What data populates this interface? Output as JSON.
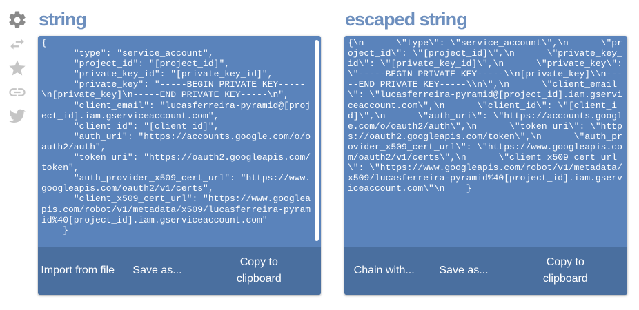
{
  "sidebar": {
    "icons": [
      {
        "name": "gear-icon",
        "color": "#8a8a8a"
      },
      {
        "name": "swap-icon",
        "color": "#c5c5c5"
      },
      {
        "name": "star-icon",
        "color": "#c5c5c5"
      },
      {
        "name": "link-icon",
        "color": "#c5c5c5"
      },
      {
        "name": "twitter-icon",
        "color": "#c5c5c5"
      }
    ]
  },
  "input_panel": {
    "title": "string",
    "content": "{\n      \"type\": \"service_account\",\n      \"project_id\": \"[project_id]\",\n      \"private_key_id\": \"[private_key_id]\",\n      \"private_key\": \"-----BEGIN PRIVATE KEY-----\\n[private_key]\\n-----END PRIVATE KEY-----\\n\",\n      \"client_email\": \"lucasferreira-pyramid@[project_id].iam.gserviceaccount.com\",\n      \"client_id\": \"[client_id]\",\n      \"auth_uri\": \"https://accounts.google.com/o/oauth2/auth\",\n      \"token_uri\": \"https://oauth2.googleapis.com/token\",\n      \"auth_provider_x509_cert_url\": \"https://www.googleapis.com/oauth2/v1/certs\",\n      \"client_x509_cert_url\": \"https://www.googleapis.com/robot/v1/metadata/x509/lucasferreira-pyramid%40[project_id].iam.gserviceaccount.com\"\n    }",
    "actions": {
      "import": "Import from file",
      "save": "Save as...",
      "copy": "Copy to clipboard"
    }
  },
  "output_panel": {
    "title": "escaped string",
    "content": "{\\n      \\\"type\\\": \\\"service_account\\\",\\n      \\\"project_id\\\": \\\"[project_id]\\\",\\n      \\\"private_key_id\\\": \\\"[private_key_id]\\\",\\n      \\\"private_key\\\": \\\"-----BEGIN PRIVATE KEY-----\\\\n[private_key]\\\\n-----END PRIVATE KEY-----\\\\n\\\",\\n      \\\"client_email\\\": \\\"lucasferreira-pyramid@[project_id].iam.gserviceaccount.com\\\",\\n      \\\"client_id\\\": \\\"[client_id]\\\",\\n      \\\"auth_uri\\\": \\\"https://accounts.google.com/o/oauth2/auth\\\",\\n      \\\"token_uri\\\": \\\"https://oauth2.googleapis.com/token\\\",\\n      \\\"auth_provider_x509_cert_url\\\": \\\"https://www.googleapis.com/oauth2/v1/certs\\\",\\n      \\\"client_x509_cert_url\\\": \\\"https://www.googleapis.com/robot/v1/metadata/x509/lucasferreira-pyramid%40[project_id].iam.gserviceaccount.com\\\"\\n    }",
    "actions": {
      "chain": "Chain with...",
      "save": "Save as...",
      "copy": "Copy to clipboard"
    }
  },
  "colors": {
    "title": "#6d8fbe",
    "panel": "#5a83bb",
    "action_bar": "#4a6f9f"
  }
}
